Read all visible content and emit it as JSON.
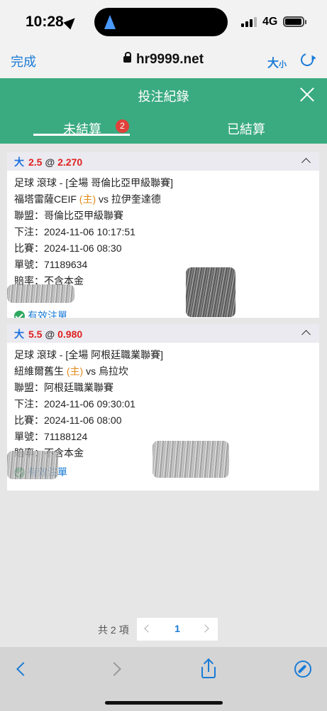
{
  "status_bar": {
    "time": "10:28",
    "network": "4G"
  },
  "browser": {
    "done_label": "完成",
    "url": "hr9999.net",
    "text_size_label": "大",
    "text_size_small": "小"
  },
  "header": {
    "title": "投注紀錄"
  },
  "tabs": [
    {
      "label": "未結算",
      "badge": "2",
      "active": true
    },
    {
      "label": "已結算",
      "active": false
    }
  ],
  "bets": [
    {
      "side": "大",
      "line": "2.5",
      "at": "@",
      "odds": "2.270",
      "sport_line": "足球 滾球 - [全場 哥倫比亞甲級聯賽]",
      "home_team": "福塔雷薩CEIF",
      "home_marker": "(主)",
      "vs": "vs",
      "away_team": "拉伊奎達德",
      "league": "聯盟：哥倫比亞甲級聯賽",
      "placed": "下注：2024-11-06 10:17:51",
      "match_time": "比賽：2024-11-06 08:30",
      "ticket": "單號：71189634",
      "odds_type": "賠率：不含本金",
      "status": "有效注單"
    },
    {
      "side": "大",
      "line": "5.5",
      "at": "@",
      "odds": "0.980",
      "sport_line": "足球 滾球 - [全場 阿根廷職業聯賽]",
      "home_team": "紐維爾舊生",
      "home_marker": "(主)",
      "vs": "vs",
      "away_team": "烏拉坎",
      "league": "聯盟：阿根廷職業聯賽",
      "placed": "下注：2024-11-06 09:30:01",
      "match_time": "比賽：2024-11-06 08:00",
      "ticket": "單號：71188124",
      "odds_type": "賠率：不含本金",
      "status": "有效注單"
    }
  ],
  "pagination": {
    "total_label": "共 2 項",
    "current_page": "1"
  },
  "colors": {
    "header_green": "#3aab80",
    "link_blue": "#1a7bd6",
    "odds_red": "#e02020",
    "badge_red": "#e0413a",
    "home_orange": "#e08a1a"
  }
}
